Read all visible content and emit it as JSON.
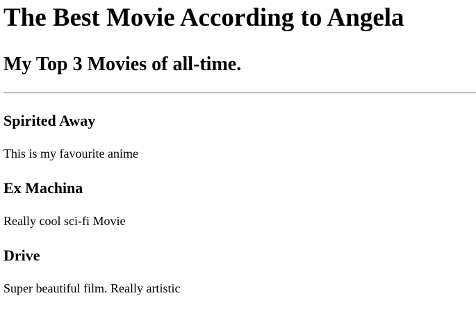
{
  "page": {
    "heading": "The Best Movie According to Angela",
    "subheading": "My Top 3 Movies of all-time."
  },
  "movies": [
    {
      "title": "Spirited Away",
      "description": "This is my favourite anime"
    },
    {
      "title": "Ex Machina",
      "description": "Really cool sci-fi Movie"
    },
    {
      "title": "Drive",
      "description": "Super beautiful film. Really artistic"
    }
  ]
}
